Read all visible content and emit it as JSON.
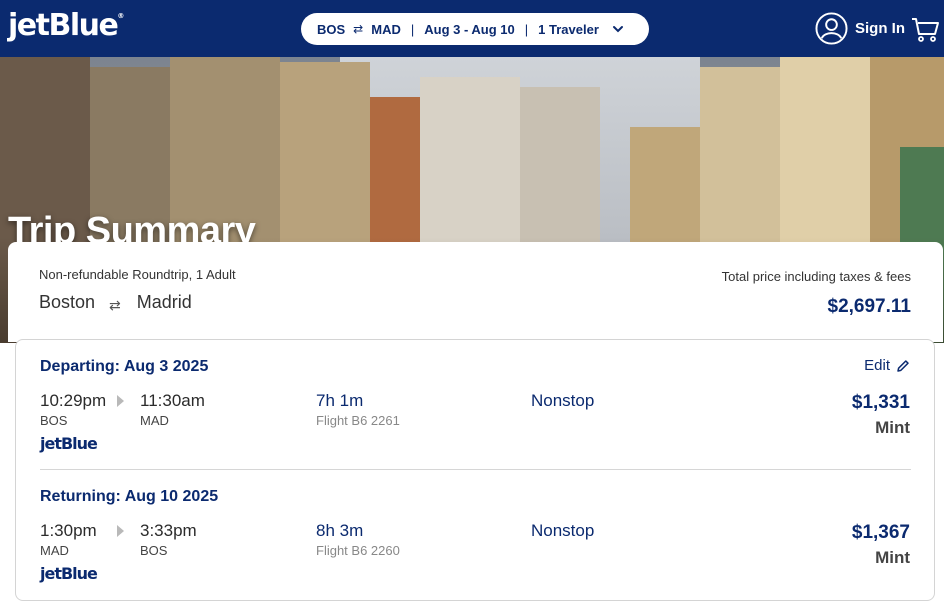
{
  "header": {
    "logo": "jetBlue",
    "search": {
      "origin": "BOS",
      "swap_symbol": "⇄",
      "destination": "MAD",
      "dates": "Aug 3 - Aug 10",
      "travelers": "1 Traveler"
    },
    "signin_label": "Sign In"
  },
  "hero": {
    "title": "Trip Summary"
  },
  "summary": {
    "fare_type": "Non-refundable Roundtrip, 1 Adult",
    "origin_city": "Boston",
    "destination_city": "Madrid",
    "total_label": "Total price including taxes & fees",
    "total_price": "$2,697.11"
  },
  "departing": {
    "title": "Departing: Aug 3 2025",
    "edit_label": "Edit",
    "depart_time": "10:29pm",
    "depart_code": "BOS",
    "arrive_time": "11:30am",
    "arrive_code": "MAD",
    "duration": "7h 1m",
    "flight_number": "Flight B6 2261",
    "stops": "Nonstop",
    "price": "$1,331",
    "cabin": "Mint",
    "carrier": "jetBlue"
  },
  "returning": {
    "title": "Returning: Aug 10 2025",
    "depart_time": "1:30pm",
    "depart_code": "MAD",
    "arrive_time": "3:33pm",
    "arrive_code": "BOS",
    "duration": "8h 3m",
    "flight_number": "Flight B6 2260",
    "stops": "Nonstop",
    "price": "$1,367",
    "cabin": "Mint",
    "carrier": "jetBlue"
  },
  "icons": {
    "swap": "swap-arrows-icon",
    "chevron": "chevron-down-icon",
    "user": "user-circle-icon",
    "cart": "shopping-cart-icon",
    "edit": "pencil-icon",
    "play": "arrow-right-icon"
  },
  "colors": {
    "brand_navy": "#0b2a6f",
    "white": "#ffffff"
  }
}
